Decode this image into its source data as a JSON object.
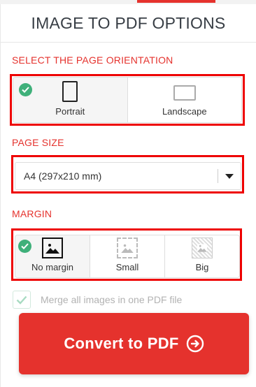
{
  "header": {
    "title": "IMAGE TO PDF OPTIONS"
  },
  "orientation": {
    "section_title": "SELECT THE PAGE ORIENTATION",
    "options": [
      {
        "label": "Portrait",
        "selected": true
      },
      {
        "label": "Landscape",
        "selected": false
      }
    ]
  },
  "page_size": {
    "section_title": "PAGE SIZE",
    "selected_value": "A4 (297x210 mm)"
  },
  "margin": {
    "section_title": "MARGIN",
    "options": [
      {
        "label": "No margin",
        "selected": true
      },
      {
        "label": "Small",
        "selected": false
      },
      {
        "label": "Big",
        "selected": false
      }
    ]
  },
  "merge": {
    "label": "Merge all images in one PDF file",
    "checked": true,
    "disabled": true
  },
  "convert_button": {
    "label": "Convert to PDF",
    "icon": "arrow-circle-right-icon"
  },
  "colors": {
    "accent": "#e5322d",
    "check": "#3fb07a",
    "highlight": "#e00000"
  }
}
